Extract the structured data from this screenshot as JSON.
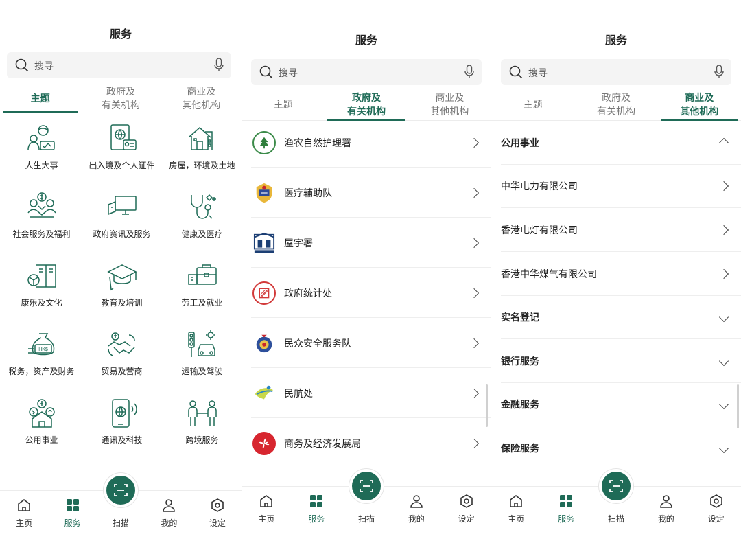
{
  "colors": {
    "brand": "#1f6b57",
    "text": "#222222",
    "muted": "#777777"
  },
  "screen1": {
    "title": "服务",
    "search_placeholder": "搜寻",
    "tabs": [
      {
        "label": "主题",
        "active": true
      },
      {
        "label": "政府及\n有关机构",
        "active": false
      },
      {
        "label": "商业及\n其他机构",
        "active": false
      }
    ],
    "grid": [
      {
        "label": "人生大事",
        "icon": "family-icon"
      },
      {
        "label": "出入境及个人证件",
        "icon": "passport-icon"
      },
      {
        "label": "房屋，环境及土地",
        "icon": "house-icon"
      },
      {
        "label": "社会服务及福利",
        "icon": "welfare-icon"
      },
      {
        "label": "政府资讯及服务",
        "icon": "computer-icon"
      },
      {
        "label": "健康及医疗",
        "icon": "stethoscope-icon"
      },
      {
        "label": "康乐及文化",
        "icon": "ball-book-icon"
      },
      {
        "label": "教育及培训",
        "icon": "graduation-cap-icon"
      },
      {
        "label": "劳工及就业",
        "icon": "briefcase-icon"
      },
      {
        "label": "税务，资产及财务",
        "icon": "money-bag-icon"
      },
      {
        "label": "贸易及营商",
        "icon": "handshake-icon"
      },
      {
        "label": "运输及驾驶",
        "icon": "traffic-car-icon"
      },
      {
        "label": "公用事业",
        "icon": "utilities-icon"
      },
      {
        "label": "通讯及科技",
        "icon": "smartphone-globe-icon"
      },
      {
        "label": "跨境服务",
        "icon": "cross-border-icon"
      }
    ]
  },
  "screen2": {
    "title": "服务",
    "search_placeholder": "搜寻",
    "tabs": [
      {
        "label": "主题",
        "active": false
      },
      {
        "label": "政府及\n有关机构",
        "active": true
      },
      {
        "label": "商业及\n其他机构",
        "active": false
      }
    ],
    "departments": [
      {
        "name": "渔农自然护理署",
        "icon": "afcd-logo-icon"
      },
      {
        "name": "医疗辅助队",
        "icon": "ams-logo-icon"
      },
      {
        "name": "屋宇署",
        "icon": "buildings-logo-icon"
      },
      {
        "name": "政府统计处",
        "icon": "censtatd-logo-icon"
      },
      {
        "name": "民众安全服务队",
        "icon": "cas-logo-icon"
      },
      {
        "name": "民航处",
        "icon": "cad-logo-icon"
      },
      {
        "name": "商务及经济发展局",
        "icon": "bauhinia-logo-icon"
      }
    ]
  },
  "screen3": {
    "title": "服务",
    "search_placeholder": "搜寻",
    "tabs": [
      {
        "label": "主题",
        "active": false
      },
      {
        "label": "政府及\n有关机构",
        "active": false
      },
      {
        "label": "商业及\n其他机构",
        "active": true
      }
    ],
    "sections": [
      {
        "name": "公用事业",
        "type": "header",
        "state": "expanded"
      },
      {
        "name": "中华电力有限公司",
        "type": "item"
      },
      {
        "name": "香港电灯有限公司",
        "type": "item"
      },
      {
        "name": "香港中华煤气有限公司",
        "type": "item"
      },
      {
        "name": "实名登记",
        "type": "header",
        "state": "collapsed"
      },
      {
        "name": "银行服务",
        "type": "header",
        "state": "collapsed"
      },
      {
        "name": "金融服务",
        "type": "header",
        "state": "collapsed"
      },
      {
        "name": "保险服务",
        "type": "header",
        "state": "collapsed"
      }
    ]
  },
  "nav": [
    {
      "label": "主页",
      "icon": "home-icon",
      "active": false
    },
    {
      "label": "服务",
      "icon": "grid-icon",
      "active": true
    },
    {
      "label": "扫描",
      "icon": "scan-icon",
      "active": false
    },
    {
      "label": "我的",
      "icon": "user-icon",
      "active": false
    },
    {
      "label": "设定",
      "icon": "settings-icon",
      "active": false
    }
  ]
}
